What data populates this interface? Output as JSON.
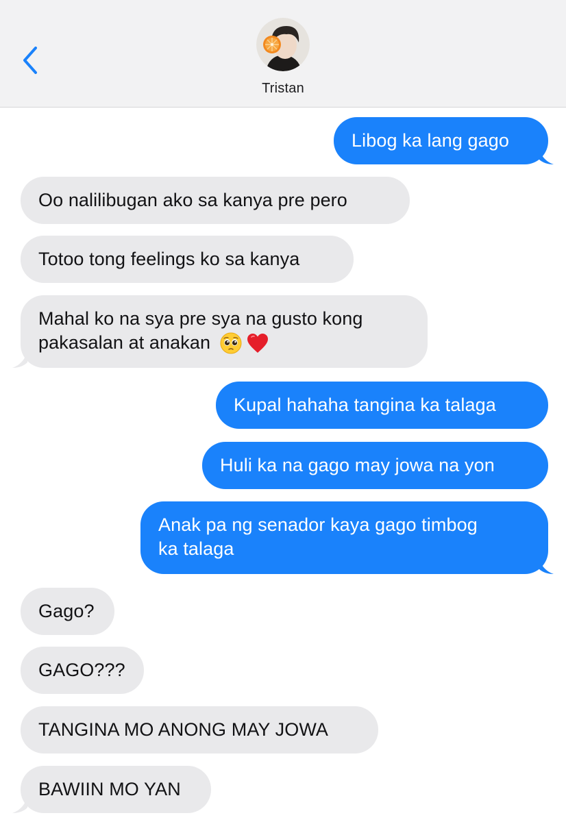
{
  "header": {
    "contact_name": "Tristan",
    "back_icon": "chevron-left-icon",
    "accent_color": "#1a82fb"
  },
  "colors": {
    "outgoing_bubble": "#1a82fb",
    "incoming_bubble": "#e9e9eb",
    "header_background": "#f2f2f3"
  },
  "messages": [
    {
      "direction": "outgoing",
      "text": "Libog ka lang gago"
    },
    {
      "direction": "incoming",
      "text": "Oo nalilibugan ako sa kanya pre pero"
    },
    {
      "direction": "incoming",
      "text": "Totoo tong feelings ko sa kanya"
    },
    {
      "direction": "incoming",
      "text_line1": "Mahal ko na sya pre sya na gusto kong",
      "text_line2": "pakasalan at anakan",
      "emojis": [
        "pleading-face",
        "red-heart"
      ]
    },
    {
      "direction": "outgoing",
      "text": "Kupal hahaha tangina ka talaga"
    },
    {
      "direction": "outgoing",
      "text": "Huli ka na gago may jowa na yon"
    },
    {
      "direction": "outgoing",
      "text_line1": "Anak pa ng senador kaya gago timbog",
      "text_line2": "ka talaga"
    },
    {
      "direction": "incoming",
      "text": "Gago?"
    },
    {
      "direction": "incoming",
      "text": "GAGO???"
    },
    {
      "direction": "incoming",
      "text": "TANGINA MO ANONG MAY JOWA"
    },
    {
      "direction": "incoming",
      "text": "BAWIIN MO YAN"
    }
  ]
}
